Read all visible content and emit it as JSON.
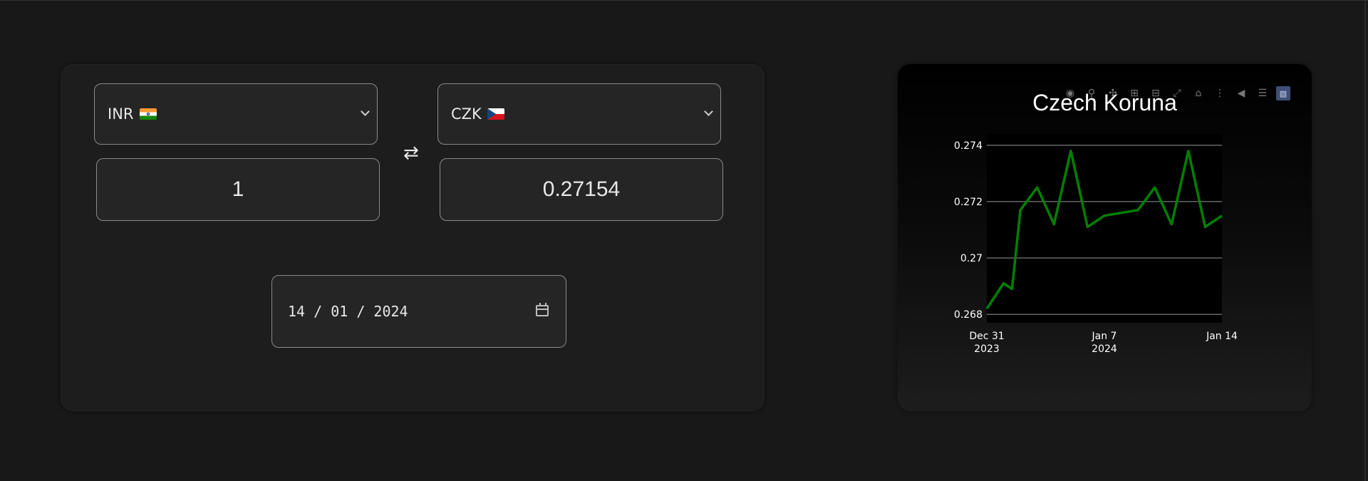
{
  "converter": {
    "from_currency": "INR",
    "to_currency": "CZK",
    "from_amount": "1",
    "to_amount": "0.27154",
    "swap_symbol": "⇄",
    "date": "14 / 01 / 2024"
  },
  "chart": {
    "title": "Czech Koruna",
    "modebar_icons": [
      "camera-icon",
      "zoom-icon",
      "pan-icon",
      "zoom-in-icon",
      "zoom-out-icon",
      "autoscale-icon",
      "home-icon",
      "spike-lines-icon",
      "compare-hover-icon",
      "closest-hover-icon",
      "plotly-logo-icon"
    ]
  },
  "chart_data": {
    "type": "line",
    "title": "Czech Koruna",
    "line_color": "#008000",
    "x": [
      "2023-12-31",
      "2024-01-01",
      "2024-01-01 12:00",
      "2024-01-02",
      "2024-01-03",
      "2024-01-04",
      "2024-01-05",
      "2024-01-06",
      "2024-01-07",
      "2024-01-08",
      "2024-01-09",
      "2024-01-10",
      "2024-01-11",
      "2024-01-12",
      "2024-01-13",
      "2024-01-14"
    ],
    "y": [
      0.2682,
      0.2691,
      0.2689,
      0.2717,
      0.2725,
      0.2712,
      0.2738,
      0.2711,
      0.2715,
      0.2716,
      0.2717,
      0.2725,
      0.2712,
      0.2738,
      0.2711,
      0.2715
    ],
    "ylim": [
      0.2677,
      0.2744
    ],
    "yticks": [
      0.268,
      0.27,
      0.272,
      0.274
    ],
    "ytick_labels": [
      "0.268",
      "0.27",
      "0.272",
      "0.274"
    ],
    "xticks": [
      {
        "line1": "Dec 31",
        "line2": "2023"
      },
      {
        "line1": "Jan 7",
        "line2": "2024"
      },
      {
        "line1": "Jan 14",
        "line2": ""
      }
    ],
    "grid": true
  }
}
